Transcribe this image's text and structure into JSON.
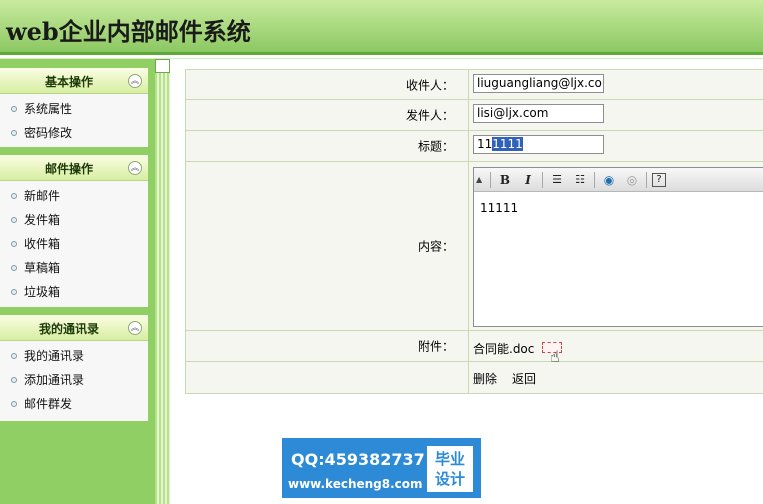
{
  "header": {
    "title": "web企业内部邮件系统"
  },
  "sidebar": {
    "groups": [
      {
        "title": "基本操作",
        "items": [
          "系统属性",
          "密码修改"
        ]
      },
      {
        "title": "邮件操作",
        "items": [
          "新邮件",
          "发件箱",
          "收件箱",
          "草稿箱",
          "垃圾箱"
        ]
      },
      {
        "title": "我的通讯录",
        "items": [
          "我的通讯录",
          "添加通讯录",
          "邮件群发"
        ]
      }
    ]
  },
  "form": {
    "recipient": {
      "label": "收件人：",
      "value": "liuguangliang@ljx.com"
    },
    "sender": {
      "label": "发件人：",
      "value": "lisi@ljx.com"
    },
    "subject": {
      "label": "标题：",
      "value_plain": "11",
      "value_selected": "1111"
    },
    "content": {
      "label": "内容：",
      "value": "11111"
    },
    "attachment": {
      "label": "附件：",
      "file_name": "合同能.doc"
    },
    "actions": {
      "delete": "删除",
      "back": "返回"
    }
  },
  "toolbar_icons": [
    "bold-icon",
    "italic-icon",
    "ordered-list-icon",
    "unordered-list-icon",
    "link-icon",
    "unlink-icon",
    "help-icon"
  ],
  "toolbar_labels": {
    "bold": "B",
    "italic": "I",
    "help": "?"
  },
  "watermark": {
    "qq": "QQ:459382737",
    "url": "www.kecheng8.com",
    "badge_line1": "毕业",
    "badge_line2": "设计"
  },
  "colors": {
    "sidebar_bg": "#8fcf63",
    "header_bg": "#8cc862",
    "selection": "#2f62b8",
    "watermark_bg": "#2d8ad6"
  }
}
